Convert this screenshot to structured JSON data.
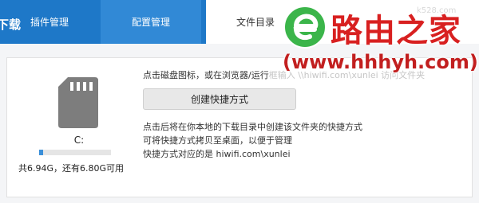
{
  "header": {
    "partial_title": "下载",
    "tabs": [
      {
        "label": "插件管理"
      },
      {
        "label": "配置管理"
      },
      {
        "label": "文件目录"
      }
    ],
    "partial_url": "k528.com"
  },
  "drive": {
    "label": "C:",
    "usage_fraction": 0.06,
    "usage_text": "共6.94G，还有6.80G可用",
    "icon": "sd-card-icon"
  },
  "instructions": {
    "hint_main": "点击磁盘图标，或在浏览器/运行",
    "hint_tail": "框输入 \\\\hiwifi.com\\xunlei 访问文件夹",
    "create_button": "创建快捷方式",
    "desc_1": "点击后将在你本地的下载目录中创建该文件夹的快捷方式",
    "desc_2": "可将快捷方式拷贝至桌面，以便于管理",
    "desc_3": "快捷方式对应的是 hiwifi.com\\xunlei"
  },
  "watermark": {
    "title": "路由之家",
    "url": "(www.hhhyh.com)",
    "logo": "e-leaf-logo"
  },
  "colors": {
    "header_bg": "#1e78c8",
    "active_tab_bg": "#ffffff",
    "mid_tab_bg": "#3189d6",
    "usage_fill": "#3a8fd9",
    "watermark_red": "#d82020",
    "logo_green": "#3bb54a"
  }
}
